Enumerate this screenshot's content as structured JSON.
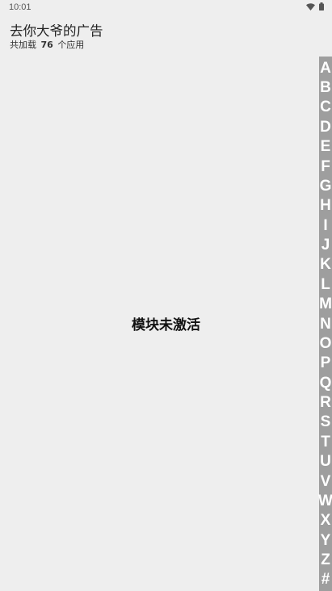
{
  "status_bar": {
    "time": "10:01",
    "icons": [
      "wifi-icon",
      "battery-icon"
    ]
  },
  "header": {
    "title": "去你大爷的广告",
    "subtitle_prefix": "共加载",
    "app_count": "76",
    "subtitle_suffix": "个应用"
  },
  "main": {
    "empty_message": "模块未激活"
  },
  "alphabet_index": [
    "A",
    "B",
    "C",
    "D",
    "E",
    "F",
    "G",
    "H",
    "I",
    "J",
    "K",
    "L",
    "M",
    "N",
    "O",
    "P",
    "Q",
    "R",
    "S",
    "T",
    "U",
    "V",
    "W",
    "X",
    "Y",
    "Z",
    "#"
  ],
  "colors": {
    "background": "#eeeeee",
    "index_bar": "#9e9e9e",
    "index_letter": "#ffffff"
  }
}
